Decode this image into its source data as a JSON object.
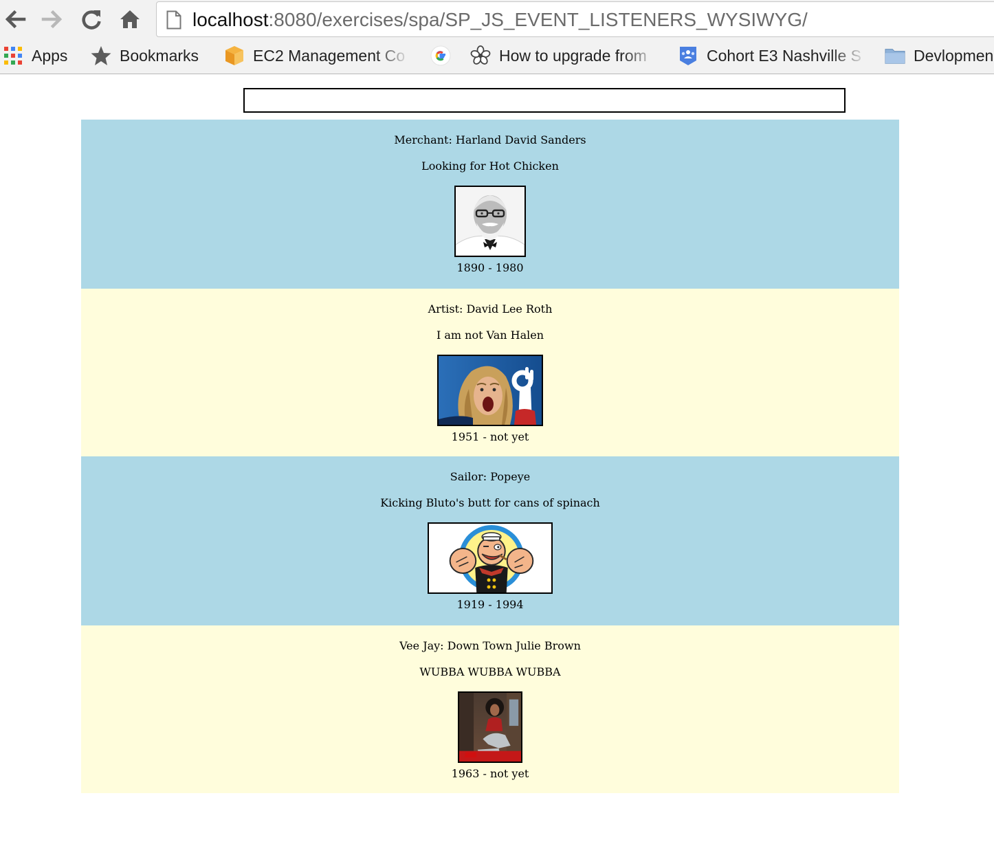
{
  "browser": {
    "url_host": "localhost",
    "url_rest": ":8080/exercises/spa/SP_JS_EVENT_LISTENERS_WYSIWYG/",
    "bookmarks": [
      {
        "label": "Apps",
        "icon": "apps-grid-icon"
      },
      {
        "label": "Bookmarks",
        "icon": "star-icon"
      },
      {
        "label": "EC2 Management Co",
        "icon": "aws-cube-icon"
      },
      {
        "label": "",
        "icon": "google-icon"
      },
      {
        "label": "How to upgrade from",
        "icon": "flower-icon"
      },
      {
        "label": "Cohort E3 Nashville S",
        "icon": "classroom-icon"
      },
      {
        "label": "Devlopmen",
        "icon": "folder-icon"
      }
    ]
  },
  "editor": {
    "value": ""
  },
  "people": [
    {
      "title": "Merchant: Harland David Sanders",
      "bio": "Looking for Hot Chicken",
      "lifespan": "1890 - 1980",
      "image": "colonel-sanders-portrait",
      "background": "#add8e6"
    },
    {
      "title": "Artist: David Lee Roth",
      "bio": "I am not Van Halen",
      "lifespan": "1951 - not yet",
      "image": "david-lee-roth-photo",
      "background": "#fffddc"
    },
    {
      "title": "Sailor: Popeye",
      "bio": "Kicking Bluto's butt for cans of spinach",
      "lifespan": "1919 - 1994",
      "image": "popeye-cartoon",
      "background": "#add8e6"
    },
    {
      "title": "Vee Jay: Down Town Julie Brown",
      "bio": "WUBBA WUBBA WUBBA",
      "lifespan": "1963 - not yet",
      "image": "julie-brown-photo",
      "background": "#fffddc"
    }
  ]
}
